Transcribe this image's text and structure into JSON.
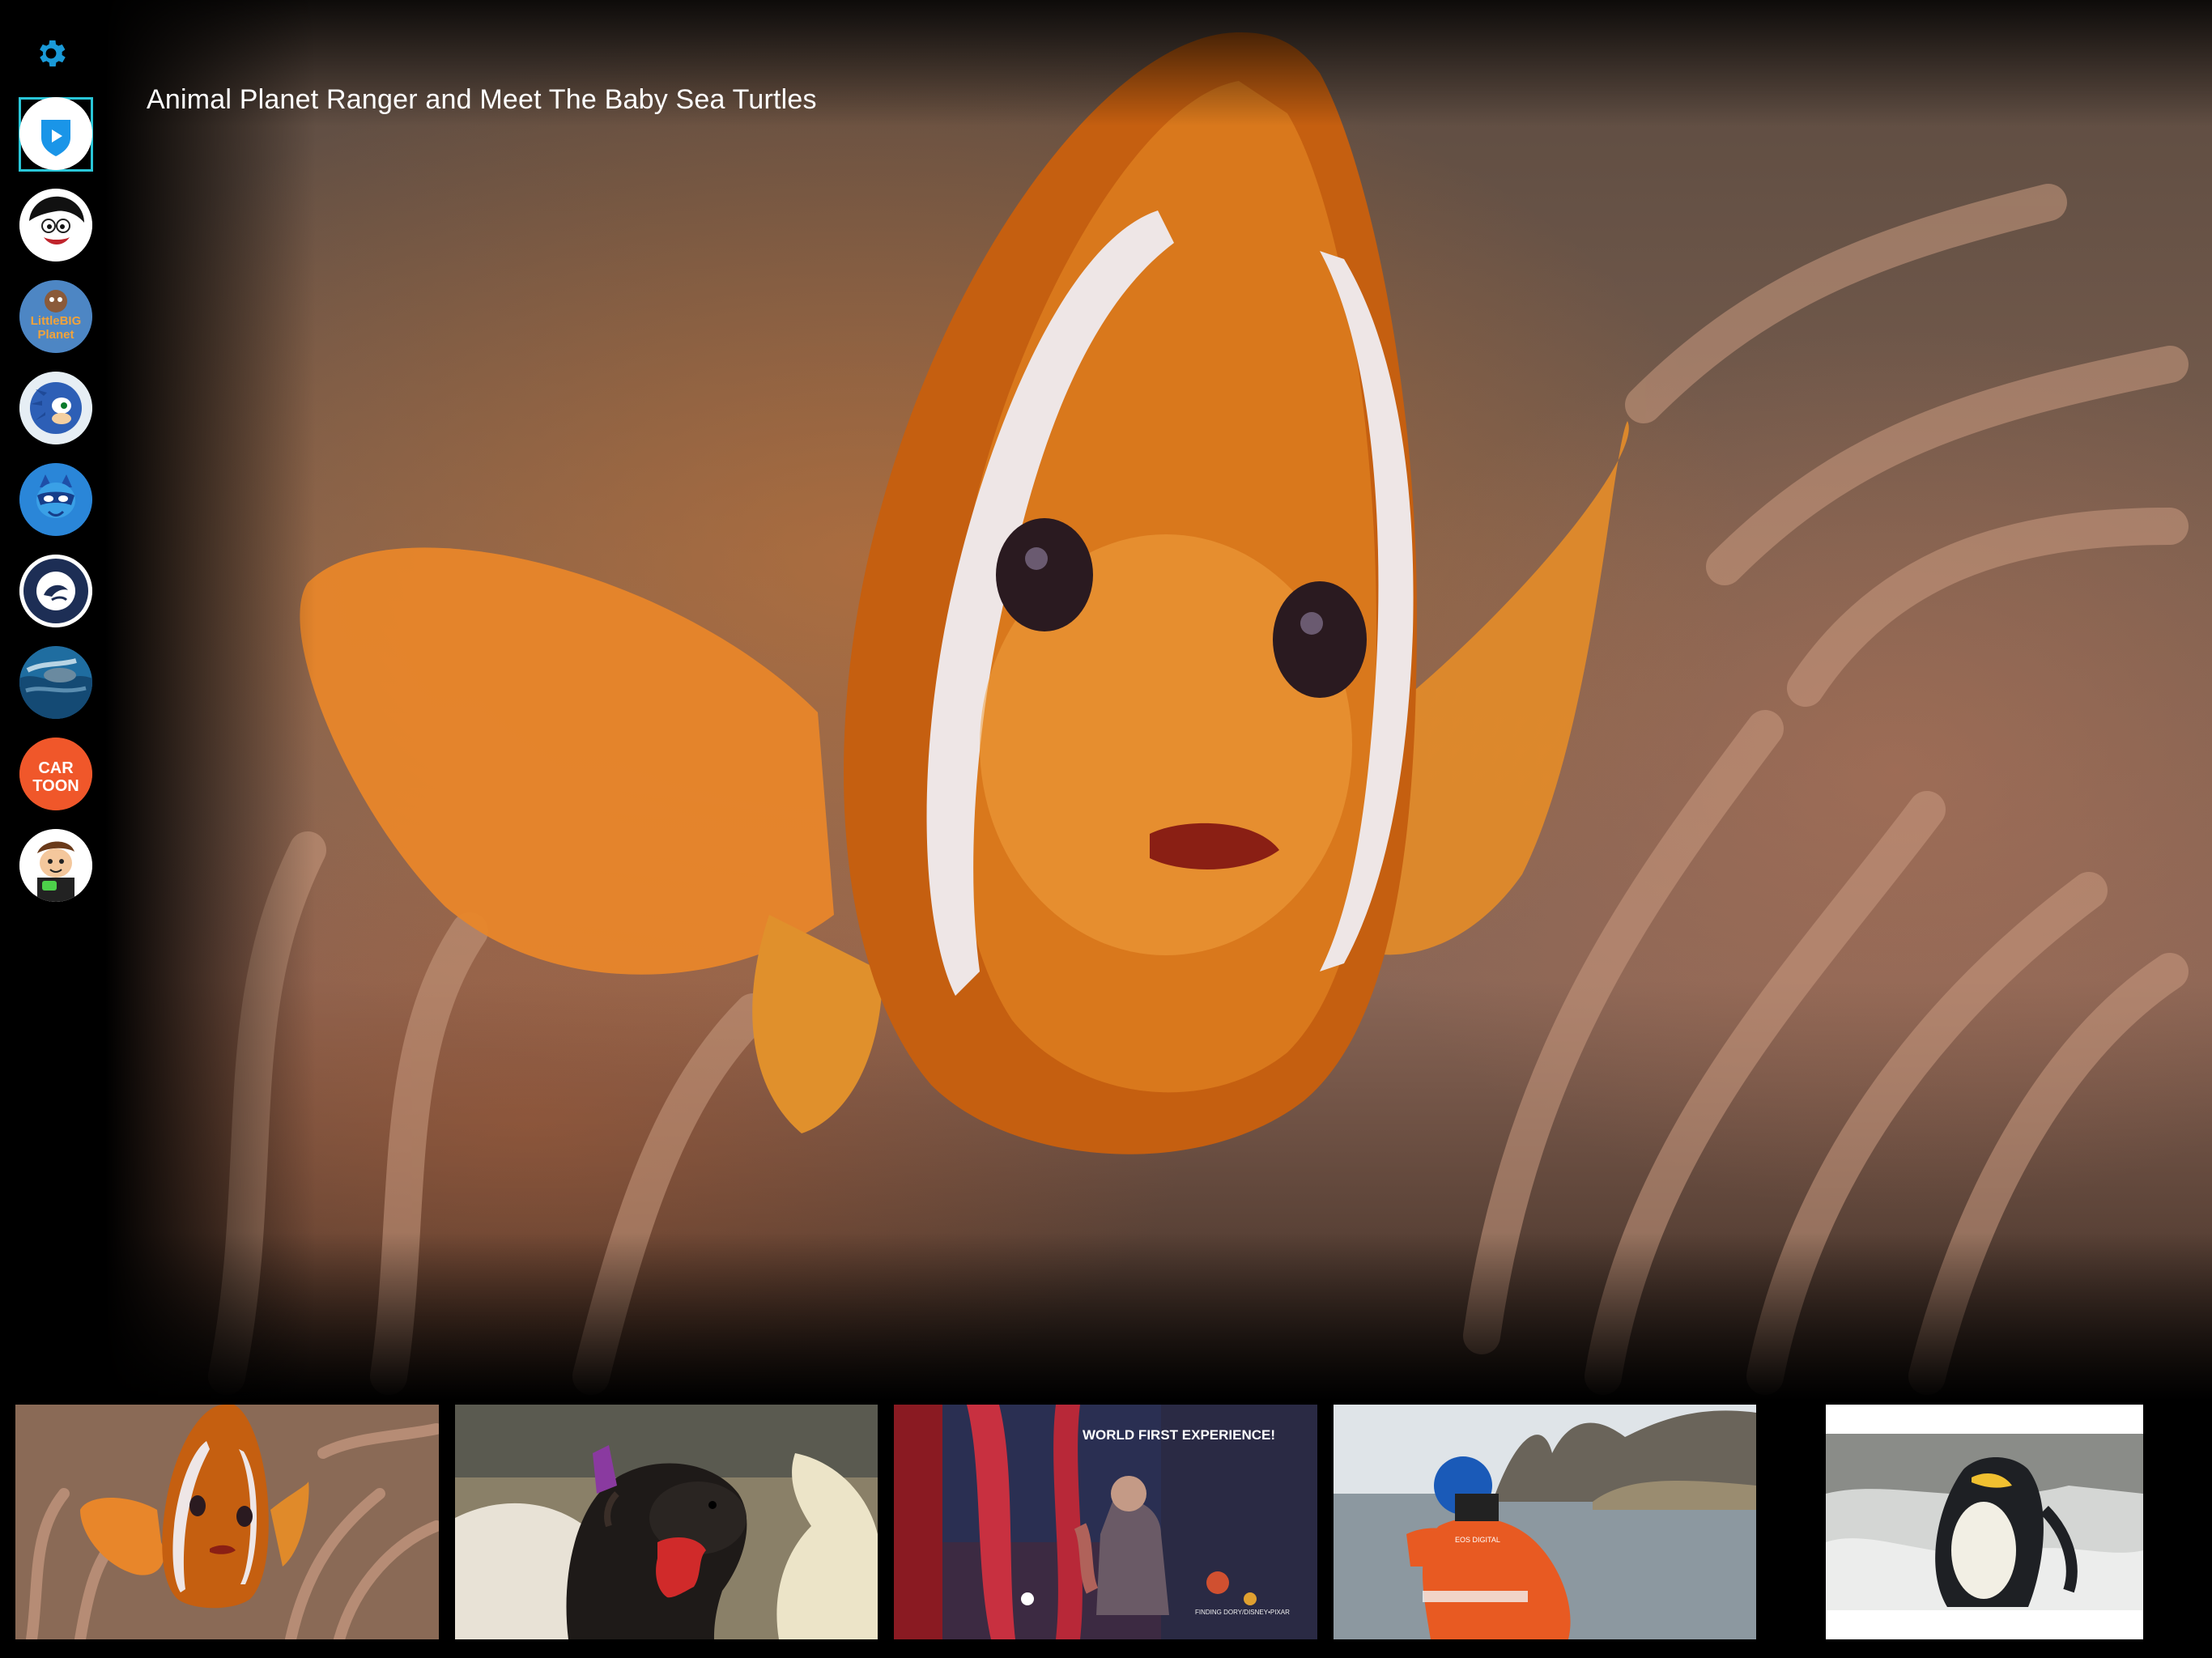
{
  "hero": {
    "title": "Animal Planet Ranger and Meet The Baby Sea Turtles"
  },
  "settings": {
    "icon": "gear-icon",
    "color": "#1a9ad8"
  },
  "channels": [
    {
      "name": "play-channel-icon",
      "selected": true
    },
    {
      "name": "monica-channel-icon"
    },
    {
      "name": "littlebigplanet-channel-icon",
      "text": "LittleBIG Planet"
    },
    {
      "name": "sonic-channel-icon"
    },
    {
      "name": "pj-masks-channel-icon"
    },
    {
      "name": "alaska-sealife-channel-icon"
    },
    {
      "name": "ocean-channel-icon"
    },
    {
      "name": "cartoon-channel-icon",
      "text_top": "CAR",
      "text_bottom": "TOON"
    },
    {
      "name": "ben10-channel-icon"
    }
  ],
  "thumbnails": [
    {
      "name": "clownfish-video",
      "active": true
    },
    {
      "name": "otter-video"
    },
    {
      "name": "aquarium-video",
      "caption": "WORLD FIRST EXPERIENCE!",
      "small": "FINDING DORY/DISNEY•PIXAR"
    },
    {
      "name": "photographer-video",
      "jacket_text": "EOS DIGITAL"
    },
    {
      "name": "penguin-video"
    }
  ],
  "colors": {
    "accent": "#29c6d8",
    "gear": "#1a9ad8"
  }
}
